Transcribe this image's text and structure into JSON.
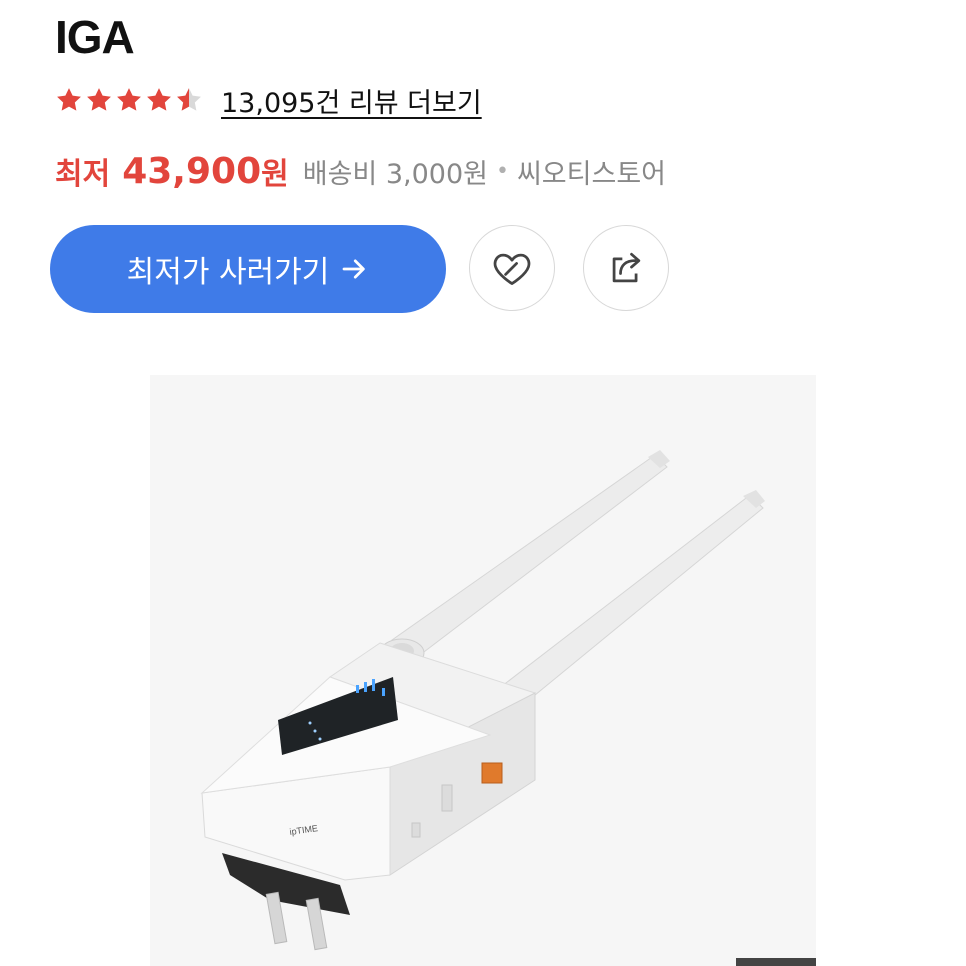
{
  "product": {
    "title": "IGA",
    "rating": 4.5,
    "rating_max": 5,
    "review_link": "13,095건 리뷰 더보기",
    "price_label": "최저",
    "price_value": "43,900",
    "price_unit": "원",
    "shipping": "배송비 3,000원",
    "separator": "•",
    "store": "씨오티스토어",
    "buy_button_label": "최저가 사러가기",
    "buy_arrow_icon": "arrow-right-icon",
    "like_icon": "heart-icon",
    "share_icon": "share-icon",
    "image_subject": "Wi-Fi range extender with two antennas",
    "device_brand": "ipTIME"
  },
  "colors": {
    "accent": "#3f7be8",
    "price": "#e2453c",
    "star": "#e2453c",
    "muted": "#888888"
  }
}
